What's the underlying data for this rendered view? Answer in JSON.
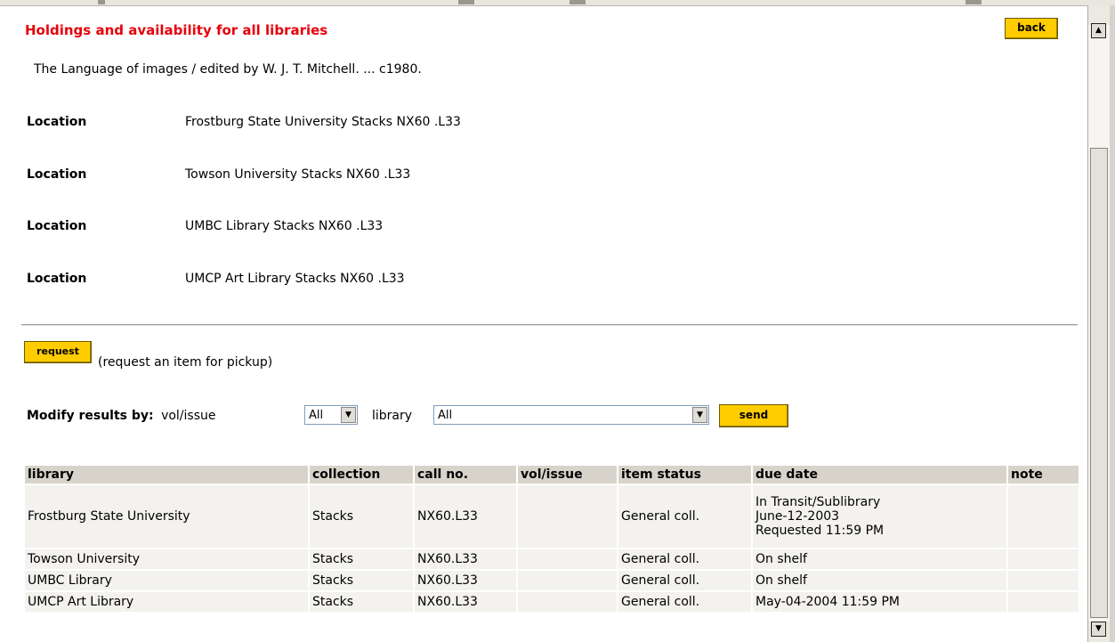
{
  "header": {
    "title": "Holdings and availability for all libraries",
    "back_label": "back"
  },
  "record": {
    "text": "The Language of images /   edited by W. J. T. Mitchell.  ... c1980."
  },
  "locations": [
    {
      "label": "Location",
      "value": "Frostburg State University Stacks NX60 .L33"
    },
    {
      "label": "Location",
      "value": "Towson University Stacks NX60 .L33"
    },
    {
      "label": "Location",
      "value": "UMBC Library Stacks NX60 .L33"
    },
    {
      "label": "Location",
      "value": "UMCP Art Library Stacks NX60 .L33"
    }
  ],
  "request": {
    "button_label": "request",
    "text": "(request an item for pickup)"
  },
  "modify": {
    "label": "Modify results by:",
    "vol_label": "vol/issue",
    "vol_value": "All",
    "library_label": "library",
    "library_value": "All",
    "send_label": "send"
  },
  "table": {
    "headers": [
      "library",
      "collection",
      "call no.",
      "vol/issue",
      "item status",
      "due date",
      "note"
    ],
    "rows": [
      {
        "library": "Frostburg State University",
        "collection": "Stacks",
        "call_no": "NX60.L33",
        "vol_issue": "",
        "item_status": "General coll.",
        "due_date": [
          "In Transit/Sublibrary",
          "June-12-2003",
          "Requested 11:59 PM"
        ],
        "note": ""
      },
      {
        "library": "Towson University",
        "collection": "Stacks",
        "call_no": "NX60.L33",
        "vol_issue": "",
        "item_status": "General coll.",
        "due_date": [
          "On shelf"
        ],
        "note": ""
      },
      {
        "library": "UMBC Library",
        "collection": "Stacks",
        "call_no": "NX60.L33",
        "vol_issue": "",
        "item_status": "General coll.",
        "due_date": [
          "On shelf"
        ],
        "note": ""
      },
      {
        "library": "UMCP Art Library",
        "collection": "Stacks",
        "call_no": "NX60.L33",
        "vol_issue": "",
        "item_status": "General coll.",
        "due_date": [
          "May-04-2004 11:59 PM"
        ],
        "note": ""
      }
    ]
  },
  "icons": {
    "scroll_up": "arrow-up-icon",
    "scroll_down": "arrow-down-icon",
    "dropdown": "chevron-down-icon"
  },
  "colors": {
    "title": "#e8000b",
    "button": "#ffcc00",
    "header_cell": "#d7d3cb",
    "data_cell": "#f4f2ee"
  }
}
